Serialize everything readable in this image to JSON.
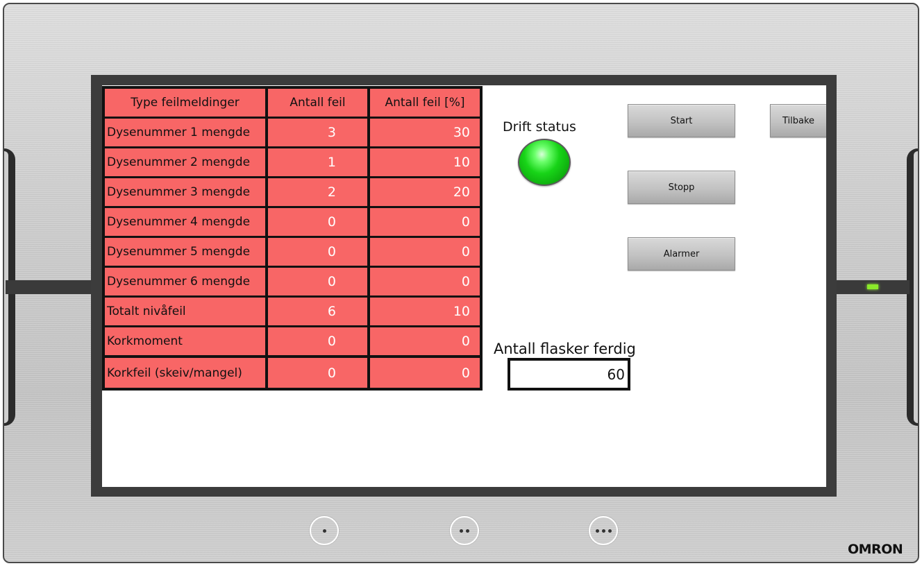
{
  "panel": {
    "brand": "OMRON",
    "function_keys": [
      {
        "name": "F1",
        "dots": 1
      },
      {
        "name": "F2",
        "dots": 2
      },
      {
        "name": "F3",
        "dots": 3
      }
    ],
    "status_led_color": "#8bea2a"
  },
  "error_table": {
    "headers": [
      "Type feilmeldinger",
      "Antall feil",
      "Antall feil [%]"
    ],
    "rows": [
      {
        "label": "Dysenummer 1 mengde",
        "count": "3",
        "percent": "30"
      },
      {
        "label": "Dysenummer 2 mengde",
        "count": "1",
        "percent": "10"
      },
      {
        "label": "Dysenummer 3 mengde",
        "count": "2",
        "percent": "20"
      },
      {
        "label": "Dysenummer 4 mengde",
        "count": "0",
        "percent": "0"
      },
      {
        "label": "Dysenummer 5 mengde",
        "count": "0",
        "percent": "0"
      },
      {
        "label": "Dysenummer 6 mengde",
        "count": "0",
        "percent": "0"
      },
      {
        "label": "Totalt nivåfeil",
        "count": "6",
        "percent": "10"
      },
      {
        "label": "Korkmoment",
        "count": "0",
        "percent": "0"
      },
      {
        "label": "Korkfeil (skeiv/mangel)",
        "count": "0",
        "percent": "0"
      }
    ],
    "cell_color": "#f86666"
  },
  "drift_status": {
    "label": "Drift status",
    "lamp_state": "on",
    "lamp_color": "#18d418"
  },
  "buttons": {
    "start": "Start",
    "stopp": "Stopp",
    "alarmer": "Alarmer",
    "tilbake": "Tilbake"
  },
  "bottles": {
    "label": "Antall flasker ferdig",
    "value": "60"
  }
}
